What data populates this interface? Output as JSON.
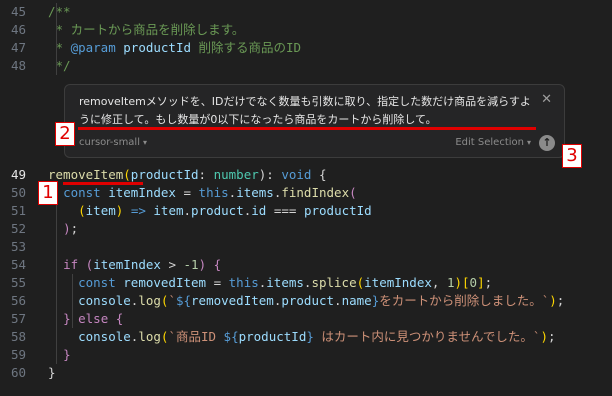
{
  "code_lines": [
    {
      "num": "45",
      "tokens": [
        {
          "t": "/**",
          "c": "t-c"
        }
      ]
    },
    {
      "num": "46",
      "tokens": [
        {
          "t": " * カートから商品を削除します。",
          "c": "t-c"
        }
      ]
    },
    {
      "num": "47",
      "tokens": [
        {
          "t": " * ",
          "c": "t-c"
        },
        {
          "t": "@param",
          "c": "t-k"
        },
        {
          "t": " ",
          "c": "t-c"
        },
        {
          "t": "productId",
          "c": "t-p"
        },
        {
          "t": " 削除する商品のID",
          "c": "t-c"
        }
      ]
    },
    {
      "num": "48",
      "tokens": [
        {
          "t": " */",
          "c": "t-c"
        }
      ]
    },
    {
      "num": "49",
      "tokens": [
        {
          "t": "removeItem",
          "c": "t-f"
        },
        {
          "t": "(",
          "c": "t-y"
        },
        {
          "t": "productId",
          "c": "t-p"
        },
        {
          "t": ": ",
          "c": "t-x"
        },
        {
          "t": "number",
          "c": "t-t"
        },
        {
          "t": "): ",
          "c": "t-x"
        },
        {
          "t": "void",
          "c": "t-k"
        },
        {
          "t": " {",
          "c": "t-x"
        }
      ]
    },
    {
      "num": "50",
      "tokens": [
        {
          "t": "  ",
          "c": "t-x"
        },
        {
          "t": "const",
          "c": "t-k"
        },
        {
          "t": " itemIndex",
          "c": "t-p"
        },
        {
          "t": " = ",
          "c": "t-x"
        },
        {
          "t": "this",
          "c": "t-k"
        },
        {
          "t": ".",
          "c": "t-x"
        },
        {
          "t": "items",
          "c": "t-p"
        },
        {
          "t": ".",
          "c": "t-x"
        },
        {
          "t": "findIndex",
          "c": "t-f"
        },
        {
          "t": "(",
          "c": "t-kw"
        }
      ]
    },
    {
      "num": "51",
      "tokens": [
        {
          "t": "    (",
          "c": "t-y"
        },
        {
          "t": "item",
          "c": "t-p"
        },
        {
          "t": ") ",
          "c": "t-y"
        },
        {
          "t": "=>",
          "c": "t-k"
        },
        {
          "t": " item",
          "c": "t-p"
        },
        {
          "t": ".",
          "c": "t-x"
        },
        {
          "t": "product",
          "c": "t-p"
        },
        {
          "t": ".",
          "c": "t-x"
        },
        {
          "t": "id",
          "c": "t-p"
        },
        {
          "t": " === ",
          "c": "t-x"
        },
        {
          "t": "productId",
          "c": "t-p"
        }
      ]
    },
    {
      "num": "52",
      "tokens": [
        {
          "t": "  ",
          "c": "t-x"
        },
        {
          "t": ")",
          "c": "t-kw"
        },
        {
          "t": ";",
          "c": "t-x"
        }
      ]
    },
    {
      "num": "53",
      "tokens": []
    },
    {
      "num": "54",
      "tokens": [
        {
          "t": "  ",
          "c": "t-x"
        },
        {
          "t": "if",
          "c": "t-kw"
        },
        {
          "t": " (",
          "c": "t-kw"
        },
        {
          "t": "itemIndex",
          "c": "t-p"
        },
        {
          "t": " > ",
          "c": "t-x"
        },
        {
          "t": "-1",
          "c": "t-n"
        },
        {
          "t": ") {",
          "c": "t-kw"
        }
      ]
    },
    {
      "num": "55",
      "tokens": [
        {
          "t": "    ",
          "c": "t-x"
        },
        {
          "t": "const",
          "c": "t-k"
        },
        {
          "t": " removedItem",
          "c": "t-p"
        },
        {
          "t": " = ",
          "c": "t-x"
        },
        {
          "t": "this",
          "c": "t-k"
        },
        {
          "t": ".",
          "c": "t-x"
        },
        {
          "t": "items",
          "c": "t-p"
        },
        {
          "t": ".",
          "c": "t-x"
        },
        {
          "t": "splice",
          "c": "t-f"
        },
        {
          "t": "(",
          "c": "t-y"
        },
        {
          "t": "itemIndex",
          "c": "t-p"
        },
        {
          "t": ", ",
          "c": "t-x"
        },
        {
          "t": "1",
          "c": "t-n"
        },
        {
          "t": ")",
          "c": "t-y"
        },
        {
          "t": "[",
          "c": "t-y"
        },
        {
          "t": "0",
          "c": "t-n"
        },
        {
          "t": "]",
          "c": "t-y"
        },
        {
          "t": ";",
          "c": "t-x"
        }
      ]
    },
    {
      "num": "56",
      "tokens": [
        {
          "t": "    ",
          "c": "t-x"
        },
        {
          "t": "console",
          "c": "t-p"
        },
        {
          "t": ".",
          "c": "t-x"
        },
        {
          "t": "log",
          "c": "t-f"
        },
        {
          "t": "(",
          "c": "t-y"
        },
        {
          "t": "`",
          "c": "t-s"
        },
        {
          "t": "${",
          "c": "t-k"
        },
        {
          "t": "removedItem",
          "c": "t-p"
        },
        {
          "t": ".",
          "c": "t-x"
        },
        {
          "t": "product",
          "c": "t-p"
        },
        {
          "t": ".",
          "c": "t-x"
        },
        {
          "t": "name",
          "c": "t-p"
        },
        {
          "t": "}",
          "c": "t-k"
        },
        {
          "t": "をカートから削除しました。`",
          "c": "t-s"
        },
        {
          "t": ")",
          "c": "t-y"
        },
        {
          "t": ";",
          "c": "t-x"
        }
      ]
    },
    {
      "num": "57",
      "tokens": [
        {
          "t": "  ",
          "c": "t-x"
        },
        {
          "t": "}",
          "c": "t-kw"
        },
        {
          "t": " else ",
          "c": "t-kw"
        },
        {
          "t": "{",
          "c": "t-kw"
        }
      ]
    },
    {
      "num": "58",
      "tokens": [
        {
          "t": "    ",
          "c": "t-x"
        },
        {
          "t": "console",
          "c": "t-p"
        },
        {
          "t": ".",
          "c": "t-x"
        },
        {
          "t": "log",
          "c": "t-f"
        },
        {
          "t": "(",
          "c": "t-y"
        },
        {
          "t": "`商品ID ",
          "c": "t-s"
        },
        {
          "t": "${",
          "c": "t-k"
        },
        {
          "t": "productId",
          "c": "t-p"
        },
        {
          "t": "}",
          "c": "t-k"
        },
        {
          "t": " はカート内に見つかりませんでした。`",
          "c": "t-s"
        },
        {
          "t": ")",
          "c": "t-y"
        },
        {
          "t": ";",
          "c": "t-x"
        }
      ]
    },
    {
      "num": "59",
      "tokens": [
        {
          "t": "  ",
          "c": "t-x"
        },
        {
          "t": "}",
          "c": "t-kw"
        }
      ]
    },
    {
      "num": "60",
      "tokens": [
        {
          "t": "}",
          "c": "t-x"
        }
      ]
    }
  ],
  "active_line": "49",
  "prompt": {
    "text": "removeItemメソッドを、IDだけでなく数量も引数に取り、指定した数だけ商品を減らすように修正して。もし数量が0以下になったら商品をカートから削除して。",
    "model_label": "cursor-small",
    "mode_label": "Edit Selection",
    "submit_icon": "↑",
    "close_icon": "✕"
  },
  "annotations": [
    "1",
    "2",
    "3"
  ],
  "colors": {
    "annotation_red": "#e00000",
    "background": "#1f1f1f"
  }
}
